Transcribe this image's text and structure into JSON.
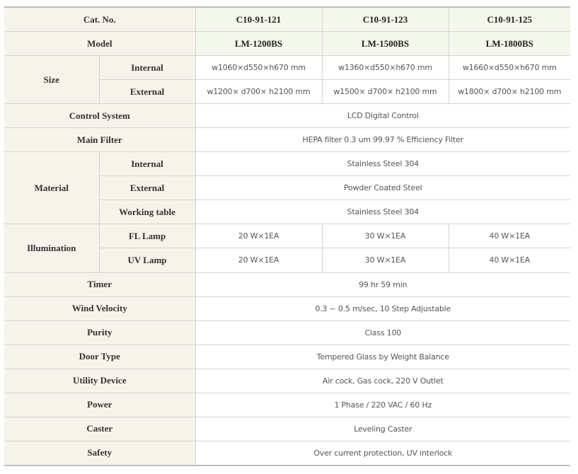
{
  "header": {
    "cat_no_label": "Cat. No.",
    "cat_nos": [
      "C10-91-121",
      "C10-91-123",
      "C10-91-125"
    ],
    "model_label": "Model",
    "models": [
      "LM-1200BS",
      "LM-1500BS",
      "LM-1800BS"
    ]
  },
  "size": {
    "label": "Size",
    "internal_label": "Internal",
    "internal": [
      "w1060×d550×h670 mm",
      "w1360×d550×h670 mm",
      "w1660×d550×h670 mm"
    ],
    "external_label": "External",
    "external": [
      "w1200× d700× h2100 mm",
      "w1500× d700× h2100 mm",
      "w1800× d700× h2100 mm"
    ]
  },
  "control_system": {
    "label": "Control System",
    "value": "LCD Digital Control"
  },
  "main_filter": {
    "label": "Main Filter",
    "value": "HEPA filter 0.3 um 99.97 % Efficiency Filter"
  },
  "material": {
    "label": "Material",
    "internal_label": "Internal",
    "internal": "Stainless Steel 304",
    "external_label": "External",
    "external": "Powder Coated Steel",
    "working_table_label": "Working table",
    "working_table": "Stainless Steel 304"
  },
  "illumination": {
    "label": "Illumination",
    "fl_label": "FL Lamp",
    "fl": [
      "20 W×1EA",
      "30 W×1EA",
      "40 W×1EA"
    ],
    "uv_label": "UV Lamp",
    "uv": [
      "20 W×1EA",
      "30 W×1EA",
      "40 W×1EA"
    ]
  },
  "timer": {
    "label": "Timer",
    "value": "99 hr 59 min"
  },
  "wind_velocity": {
    "label": "Wind Velocity",
    "value": "0.3 ~ 0.5 m/sec, 10 Step Adjustable"
  },
  "purity": {
    "label": "Purity",
    "value": "Class 100"
  },
  "door_type": {
    "label": "Door Type",
    "value": "Tempered Glass by Weight Balance"
  },
  "utility_device": {
    "label": "Utility Device",
    "value": "Air cock, Gas cock, 220 V Outlet"
  },
  "power": {
    "label": "Power",
    "value": "1 Phase / 220 VAC / 60 Hz"
  },
  "caster": {
    "label": "Caster",
    "value": "Leveling Caster"
  },
  "safety": {
    "label": "Safety",
    "value": "Over current protection, UV interlock"
  }
}
